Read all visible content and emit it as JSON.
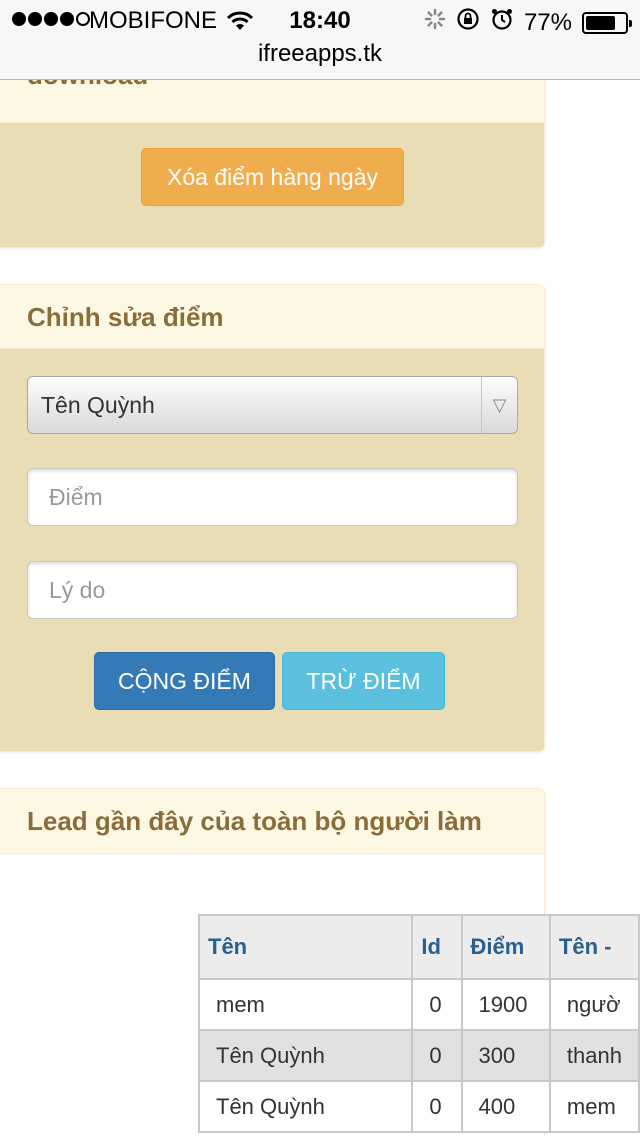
{
  "status_bar": {
    "carrier": "MOBIFONE",
    "time": "18:40",
    "battery": "77%",
    "battery_level": 0.77
  },
  "browser": {
    "url": "ifreeapps.tk"
  },
  "panel_download": {
    "heading_partial": "download",
    "clear_button": "Xóa điểm hàng ngày"
  },
  "panel_edit": {
    "heading": "Chỉnh sửa điểm",
    "selected_user": "Tên Quỳnh",
    "score_placeholder": "Điểm",
    "reason_placeholder": "Lý do",
    "add_button": "CỘNG ĐIỂM",
    "subtract_button": "TRỪ ĐIỂM"
  },
  "panel_leads": {
    "heading": "Lead gần đây của toàn bộ người làm",
    "columns": [
      "Tên",
      "Id",
      "Điểm",
      "Tên -"
    ],
    "rows": [
      {
        "name": "mem",
        "id": "0",
        "score": "1900",
        "extra": "ngườ"
      },
      {
        "name": "Tên Quỳnh",
        "id": "0",
        "score": "300",
        "extra": "thanh"
      },
      {
        "name": "Tên Quỳnh",
        "id": "0",
        "score": "400",
        "extra": "mem"
      }
    ]
  },
  "colors": {
    "panel_body": "#e8ddb5",
    "panel_heading": "#fcf8e3",
    "heading_text": "#8a6d3b",
    "warning": "#f0ad4e",
    "primary": "#337ab7",
    "info": "#5bc0de"
  }
}
